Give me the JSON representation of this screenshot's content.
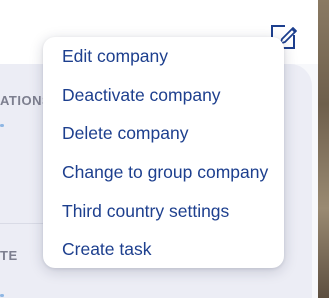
{
  "background": {
    "sections": [
      {
        "label": "ATIONS"
      },
      {
        "label": "TE"
      }
    ]
  },
  "edit_icon": {
    "name": "edit-icon",
    "color": "#1d3f8e"
  },
  "menu": {
    "items": [
      {
        "label": "Edit company"
      },
      {
        "label": "Deactivate company"
      },
      {
        "label": "Delete company"
      },
      {
        "label": "Change to group company"
      },
      {
        "label": "Third country settings"
      },
      {
        "label": "Create task"
      }
    ]
  },
  "colors": {
    "menu_text": "#1d3f8e",
    "section_label": "#7d7f8f",
    "accent": "#8fb7e4"
  }
}
